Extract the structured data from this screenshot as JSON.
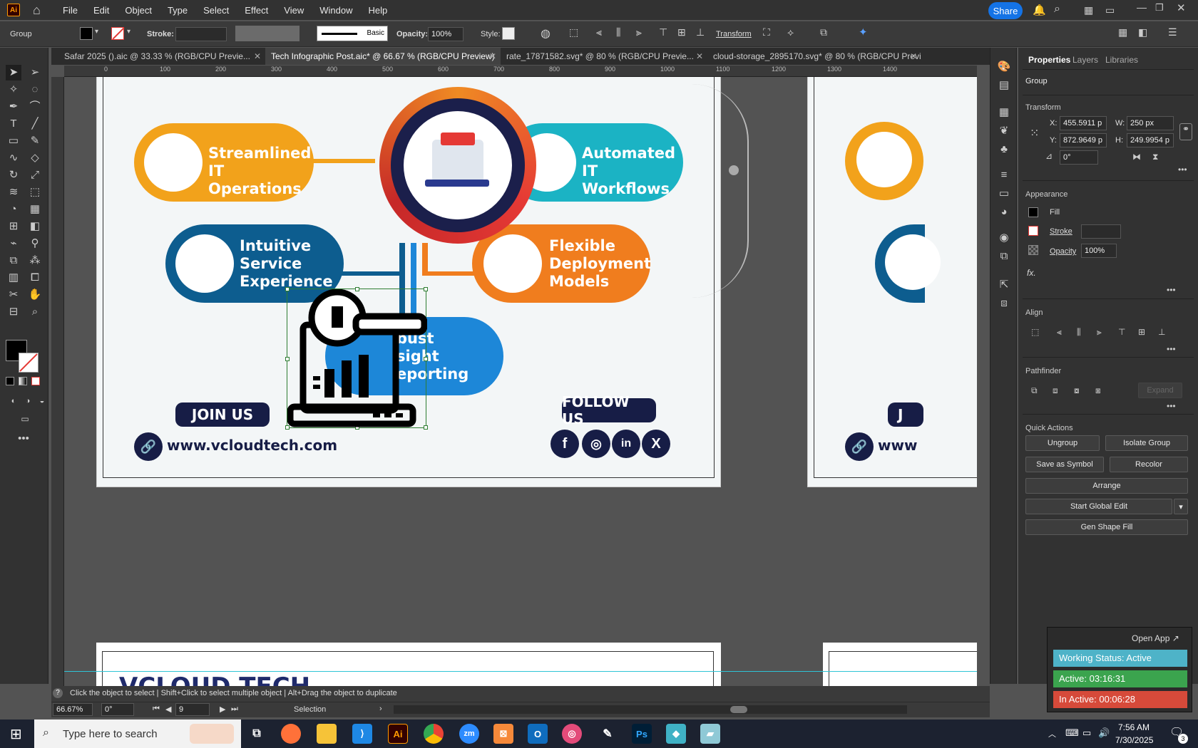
{
  "app": {
    "logo": "Ai",
    "home_icon": "home-icon"
  },
  "menu": [
    "File",
    "Edit",
    "Object",
    "Type",
    "Select",
    "Effect",
    "View",
    "Window",
    "Help"
  ],
  "share_label": "Share",
  "control_bar": {
    "selection_type": "Group",
    "stroke_label": "Stroke:",
    "brush_label": "Basic",
    "opacity_label": "Opacity:",
    "opacity_value": "100%",
    "style_label": "Style:",
    "transform_label": "Transform"
  },
  "tabs": [
    {
      "label": "Safar 2025 ().aic @ 33.33 % (RGB/CPU Previe..."
    },
    {
      "label": "Tech Infographic Post.aic* @ 66.67 % (RGB/CPU Preview)"
    },
    {
      "label": "rate_17871582.svg* @ 80 % (RGB/CPU Previe..."
    },
    {
      "label": "cloud-storage_2895170.svg* @ 80 % (RGB/CPU Previe..."
    }
  ],
  "ruler_h": [
    "0",
    "100",
    "200",
    "300",
    "400",
    "500",
    "600",
    "700",
    "800",
    "900",
    "1000",
    "1100",
    "1200",
    "1300",
    "1400"
  ],
  "infographic": {
    "items": [
      {
        "title": "Streamlined IT Operations",
        "line1": "Streamlined",
        "line2": "IT Operations",
        "color": "#f2a21b"
      },
      {
        "title": "Automated IT Workflows",
        "line1": "Automated",
        "line2": "IT Workflows",
        "color": "#1bb3c4"
      },
      {
        "title": "Intuitive Service Experience",
        "line1": "Intuitive",
        "line2": "Service",
        "line3": "Experience",
        "color": "#0d5d8f"
      },
      {
        "title": "Flexible Deployment Models",
        "line1": "Flexible",
        "line2": "Deployment",
        "line3": "Models",
        "color": "#f07d1e"
      },
      {
        "title": "Robust Insight Reporting",
        "line1": "bust",
        "line2": "sight",
        "line3": "eporting",
        "color": "#1d87d8"
      }
    ],
    "join_us": "JOIN US",
    "follow_us": "FOLLOW US",
    "website": "www.vcloudtech.com",
    "website_partial": "www",
    "partial_letter": "J",
    "social": [
      "facebook-icon",
      "instagram-icon",
      "linkedin-icon",
      "x-icon"
    ],
    "next_artboard_logo": "VCLOUD TECH"
  },
  "right_panel": {
    "tabs": [
      "Properties",
      "Layers",
      "Libraries"
    ],
    "selection": "Group",
    "transform_title": "Transform",
    "x_label": "X:",
    "x_value": "455.5911 p",
    "y_label": "Y:",
    "y_value": "872.9649 p",
    "w_label": "W:",
    "w_value": "250 px",
    "h_label": "H:",
    "h_value": "249.9954 p",
    "angle_value": "0°",
    "appearance_title": "Appearance",
    "fill_label": "Fill",
    "stroke_label": "Stroke",
    "opacity_label": "Opacity",
    "opacity_value": "100%",
    "fx_label": "fx.",
    "align_title": "Align",
    "pathfinder_title": "Pathfinder",
    "expand_label": "Expand",
    "quick_actions_title": "Quick Actions",
    "buttons": {
      "ungroup": "Ungroup",
      "isolate": "Isolate Group",
      "save_symbol": "Save as Symbol",
      "recolor": "Recolor",
      "arrange": "Arrange",
      "global_edit": "Start Global Edit",
      "gen_fill": "Gen Shape Fill"
    }
  },
  "status_hint": "Click the object to select  |  Shift+Click to select multiple object  |  Alt+Drag the object to duplicate",
  "zoom_bar": {
    "zoom": "66.67%",
    "angle": "0°",
    "page": "9",
    "mode": "Selection"
  },
  "tracker": {
    "open_app": "Open App ↗",
    "working": "Working Status: Active",
    "active": "Active: 03:16:31",
    "inactive": "In Active: 00:06:28"
  },
  "taskbar": {
    "search_placeholder": "Type here to search",
    "time": "7:56 AM",
    "date": "7/30/2025",
    "notifications": "3"
  }
}
